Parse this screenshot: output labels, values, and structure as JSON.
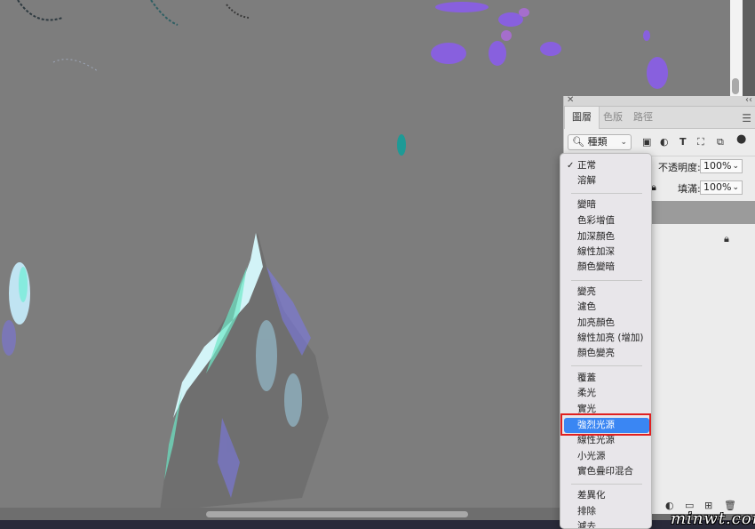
{
  "panel": {
    "tabs": [
      {
        "label": "圖層"
      },
      {
        "label": "色版"
      },
      {
        "label": "路徑"
      }
    ],
    "filter": {
      "kind_label": "種類"
    },
    "opacity_label": "不透明度:",
    "opacity_value": "100%",
    "fill_label": "填滿:",
    "fill_value": "100%"
  },
  "blend_menu": {
    "groups": [
      [
        "正常",
        "溶解"
      ],
      [
        "變暗",
        "色彩增值",
        "加深顏色",
        "線性加深",
        "顏色變暗"
      ],
      [
        "變亮",
        "濾色",
        "加亮顏色",
        "線性加亮 (增加)",
        "顏色變亮"
      ],
      [
        "覆蓋",
        "柔光",
        "實光",
        "強烈光源",
        "線性光源",
        "小光源",
        "實色疊印混合"
      ],
      [
        "差異化",
        "排除",
        "減去"
      ]
    ],
    "checked": "正常",
    "highlighted": "強烈光源"
  },
  "colors": {
    "highlight": "#3a86f3",
    "annotation": "#e02020",
    "canvas": "#7d7d7d"
  },
  "watermark": "minwt.com"
}
